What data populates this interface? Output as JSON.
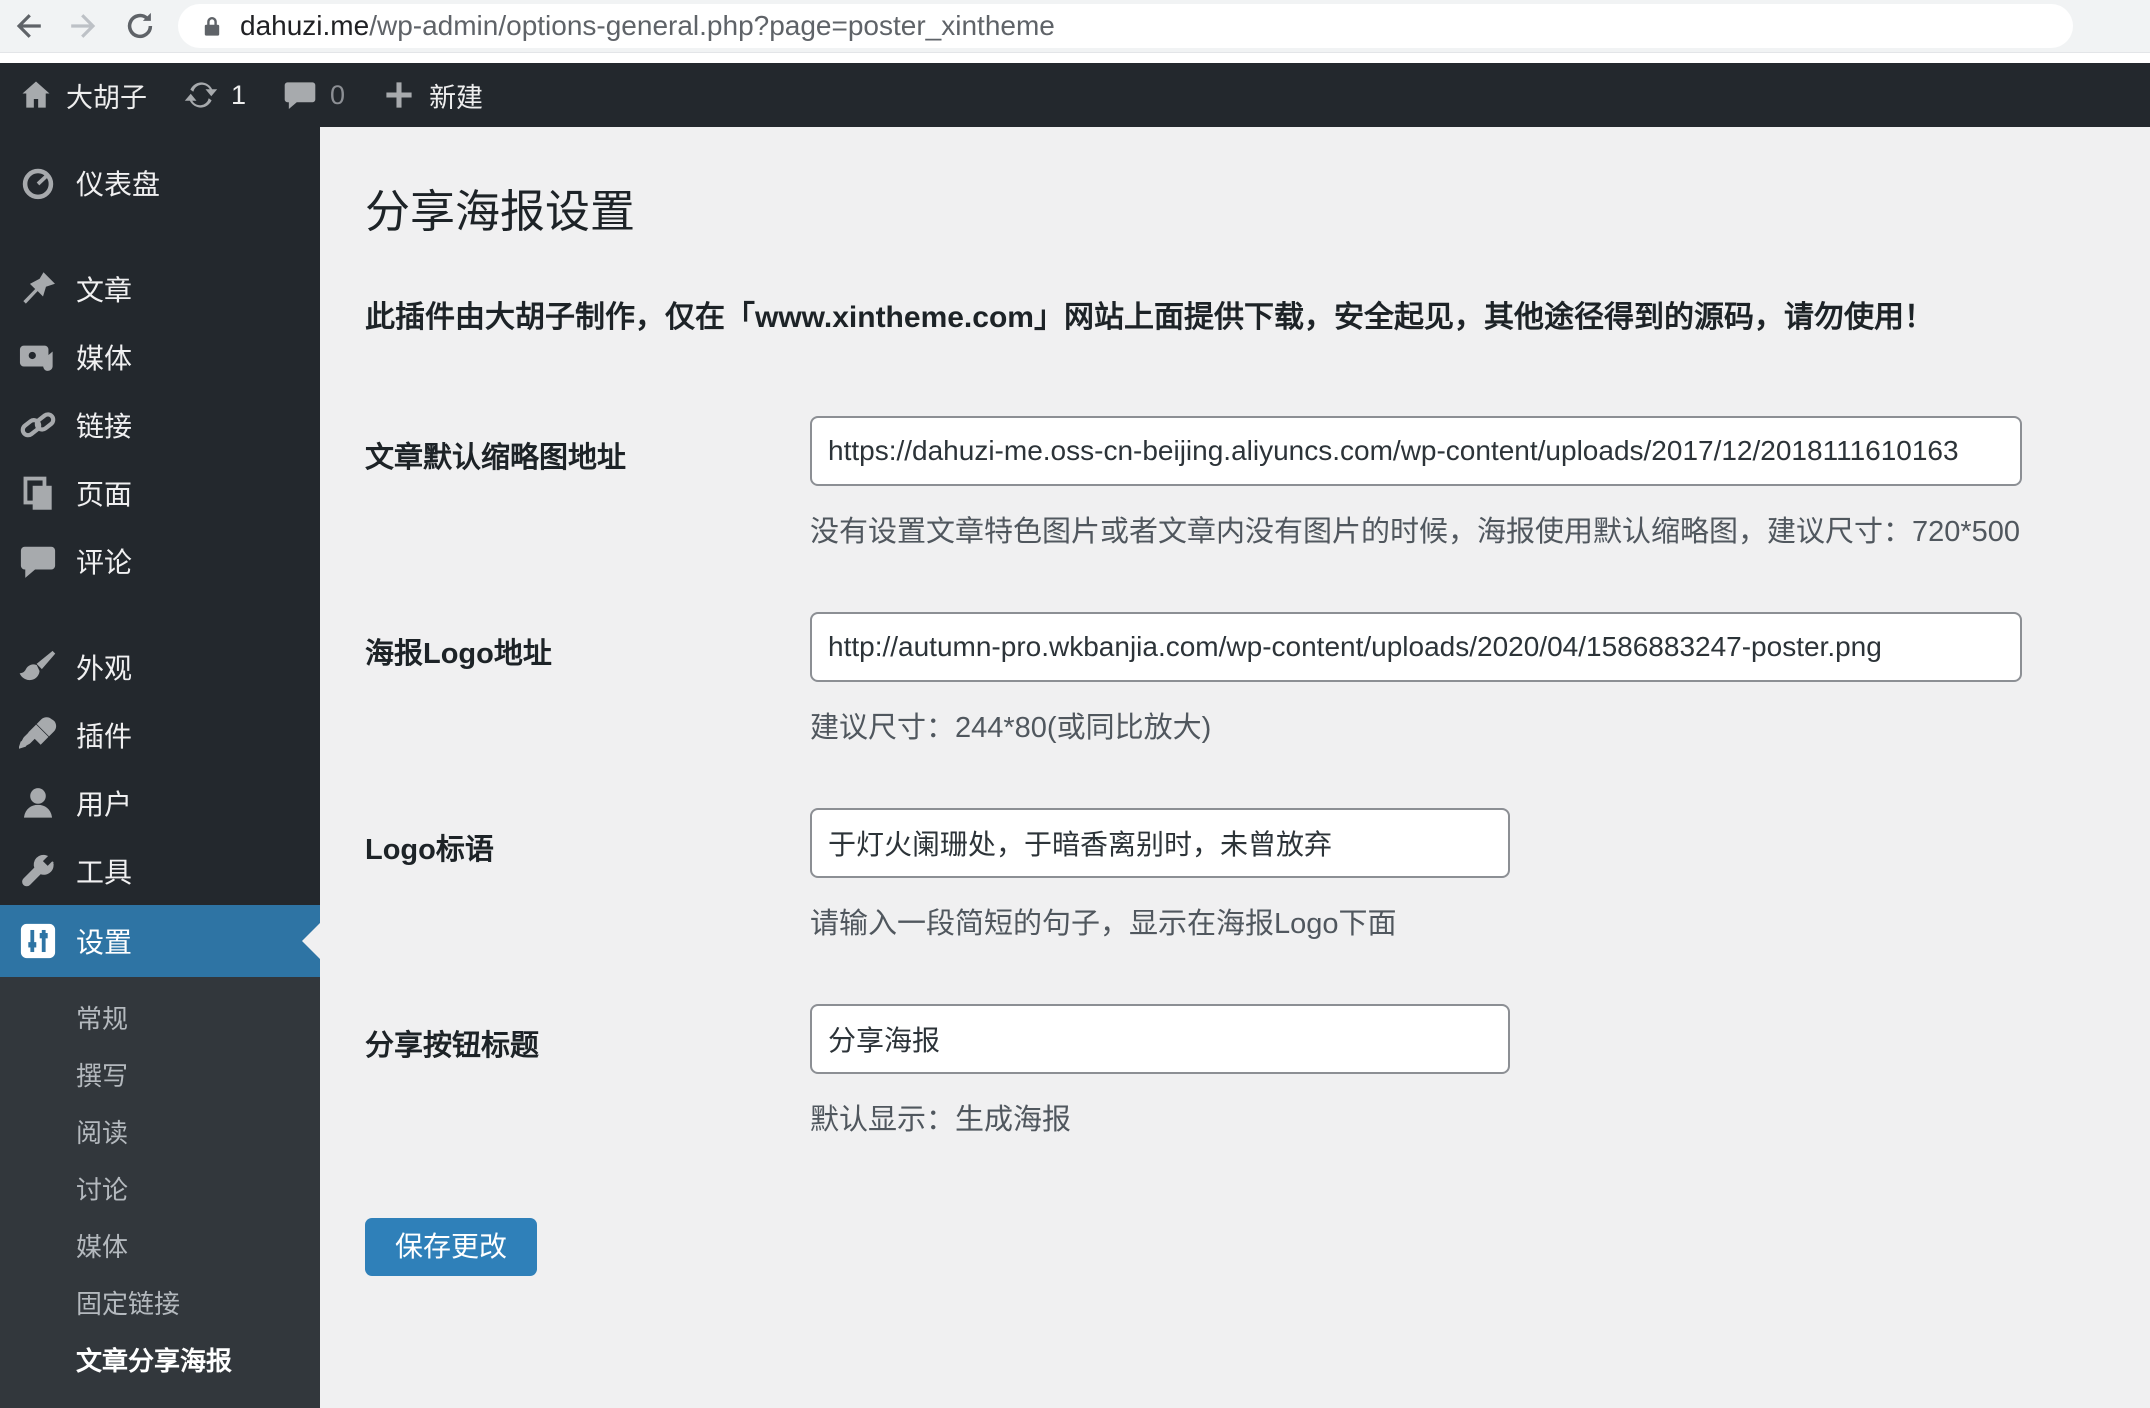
{
  "browser": {
    "url_host": "dahuzi.me",
    "url_path": "/wp-admin/options-general.php?page=poster_xintheme"
  },
  "admin_bar": {
    "site_name": "大胡子",
    "update_count": "1",
    "comment_count": "0",
    "new_label": "新建"
  },
  "sidebar": {
    "items": [
      {
        "label": "仪表盘",
        "icon": "dashboard-icon"
      },
      {
        "label": "文章",
        "icon": "pin-icon"
      },
      {
        "label": "媒体",
        "icon": "media-icon"
      },
      {
        "label": "链接",
        "icon": "link-icon"
      },
      {
        "label": "页面",
        "icon": "pages-icon"
      },
      {
        "label": "评论",
        "icon": "comments-icon"
      },
      {
        "label": "外观",
        "icon": "appearance-icon"
      },
      {
        "label": "插件",
        "icon": "plugin-icon"
      },
      {
        "label": "用户",
        "icon": "users-icon"
      },
      {
        "label": "工具",
        "icon": "tools-icon"
      },
      {
        "label": "设置",
        "icon": "settings-icon",
        "active": true
      }
    ],
    "settings_submenu": [
      {
        "label": "常规"
      },
      {
        "label": "撰写"
      },
      {
        "label": "阅读"
      },
      {
        "label": "讨论"
      },
      {
        "label": "媒体"
      },
      {
        "label": "固定链接"
      },
      {
        "label": "文章分享海报",
        "current": true
      }
    ]
  },
  "main": {
    "title": "分享海报设置",
    "notice": "此插件由大胡子制作，仅在「www.xintheme.com」网站上面提供下载，安全起见，其他途径得到的源码，请勿使用！",
    "fields": [
      {
        "label": "文章默认缩略图地址",
        "value": "https://dahuzi-me.oss-cn-beijing.aliyuncs.com/wp-content/uploads/2017/12/2018111610163",
        "help": "没有设置文章特色图片或者文章内没有图片的时候，海报使用默认缩略图，建议尺寸：720*500"
      },
      {
        "label": "海报Logo地址",
        "value": "http://autumn-pro.wkbanjia.com/wp-content/uploads/2020/04/1586883247-poster.png",
        "help": "建议尺寸：244*80(或同比放大)"
      },
      {
        "label": "Logo标语",
        "value": "于灯火阑珊处，于暗香离别时，未曾放弃",
        "help": "请输入一段简短的句子，显示在海报Logo下面"
      },
      {
        "label": "分享按钮标题",
        "value": "分享海报",
        "help": "默认显示：生成海报"
      }
    ],
    "save_label": "保存更改"
  },
  "colors": {
    "admin_dark": "#23282d",
    "submenu_bg": "#32373c",
    "menu_active_blue": "#2e74a4",
    "button_blue": "#2f80b9",
    "content_bg": "#f0f0f1",
    "chrome_bg": "#f1f3f4"
  }
}
